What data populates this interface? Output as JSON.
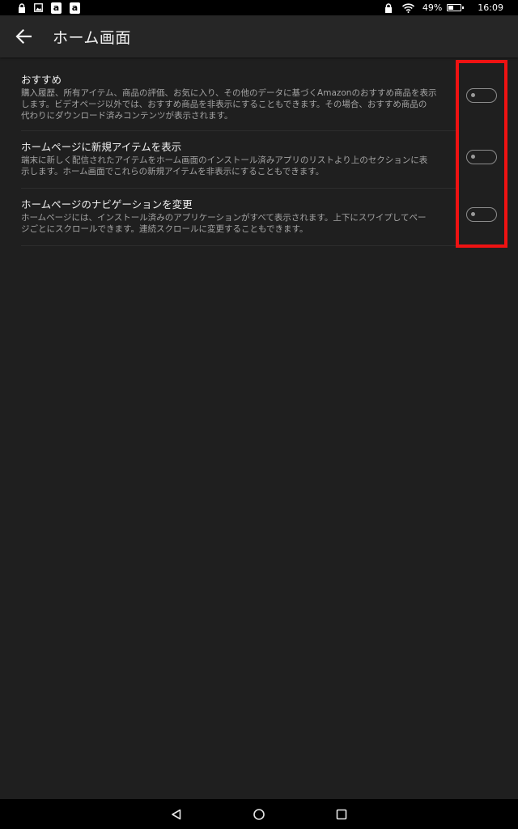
{
  "status_bar": {
    "left_icons": [
      "lock-icon",
      "image-icon",
      "amazon-icon",
      "amazon-icon"
    ],
    "amazon_glyph": "a",
    "battery_level": 0.49,
    "battery_text": "49%",
    "time": "16:09",
    "icons": [
      "lock-icon",
      "wifi-icon",
      "battery-icon"
    ]
  },
  "toolbar": {
    "back_icon": "arrow-left-icon",
    "title": "ホーム画面"
  },
  "settings": [
    {
      "title": "おすすめ",
      "description_lines": [
        "購入履歴、所有アイテム、商品の評価、お気に入り、その他のデータに基づくAmazonのおすすめ商品を表示",
        "します。ビデオページ以外では、おすすめ商品を非表示にすることもできます。その場合、おすすめ商品の",
        "代わりにダウンロード済みコンテンツが表示されます。"
      ],
      "enabled": false
    },
    {
      "title": "ホームページに新規アイテムを表示",
      "description_lines": [
        "端末に新しく配信されたアイテムをホーム画面のインストール済みアプリのリストより上のセクションに表",
        "示します。ホーム画面でこれらの新規アイテムを非表示にすることもできます。"
      ],
      "enabled": false
    },
    {
      "title": "ホームページのナビゲーションを変更",
      "description_lines": [
        "ホームページには、インストール済みのアプリケーションがすべて表示されます。上下にスワイプしてペー",
        "ジごとにスクロールできます。連続スクロールに変更することもできます。"
      ],
      "enabled": false
    }
  ],
  "highlight_color": "#ee1212",
  "nav_bar": {
    "icons": [
      "back-triangle-icon",
      "home-circle-icon",
      "recents-square-icon"
    ]
  }
}
